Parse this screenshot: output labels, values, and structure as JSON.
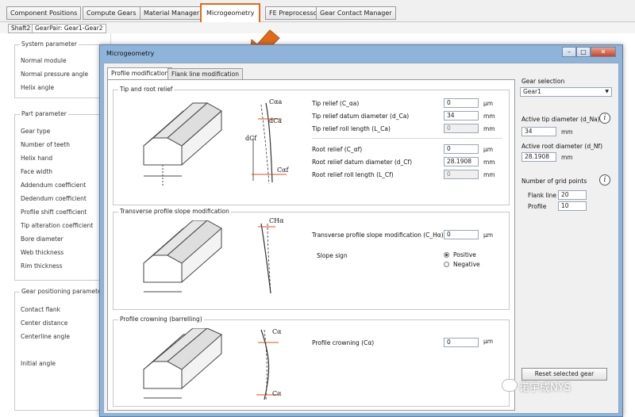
{
  "top_tabs": [
    {
      "label": "Component Positions"
    },
    {
      "label": "Compute Gears"
    },
    {
      "label": "Material Manager"
    },
    {
      "label": "Microgeometry"
    },
    {
      "label": "FE Preprocessor"
    },
    {
      "label": "Gear Contact Manager"
    }
  ],
  "sub_tabs": [
    {
      "label": "Shaft2"
    },
    {
      "label": "GearPair: Gear1-Gear2"
    }
  ],
  "background_panel": {
    "system_group": "System parameter",
    "system_labels": [
      "Normal module",
      "Normal pressure angle",
      "Helix angle"
    ],
    "part_group": "Part parameter",
    "part_labels": [
      "Gear type",
      "Number of teeth",
      "Helix hand",
      "Face width",
      "Addendum coefficient",
      "Dedendum coefficient",
      "Profile shift coefficient",
      "Tip alteration coefficient",
      "Bore diameter",
      "Web thickness",
      "Rim thickness"
    ],
    "positioning_group": "Gear positioning parameter",
    "positioning_labels": [
      "Contact flank",
      "Center distance",
      "Centerline angle",
      "Initial angle"
    ]
  },
  "dialog": {
    "title": "Microgeometry",
    "window_buttons": {
      "minimize": "–",
      "maximize": "□",
      "close": "✕"
    },
    "tabs": [
      {
        "label": "Profile modification"
      },
      {
        "label": "Flank line modification"
      }
    ],
    "tip_root": {
      "title": "Tip and root relief",
      "diagram_labels": {
        "c_alpha_a": "Cαa",
        "d_ca": "dCa",
        "d_cf": "dCf",
        "c_alpha_f": "Cαf"
      },
      "rows": [
        {
          "label": "Tip relief (C_αa)",
          "value": "0",
          "unit": "µm"
        },
        {
          "label": "Tip relief datum diameter (d_Ca)",
          "value": "34",
          "unit": "mm"
        },
        {
          "label": "Tip relief roll length (L_Ca)",
          "value": "0",
          "unit": "mm"
        },
        {
          "label": "Root relief (C_αf)",
          "value": "0",
          "unit": "µm"
        },
        {
          "label": "Root relief datum diameter (d_Cf)",
          "value": "28.1908",
          "unit": "mm"
        },
        {
          "label": "Root relief roll length (L_Cf)",
          "value": "0",
          "unit": "mm"
        }
      ]
    },
    "transverse": {
      "title": "Transverse profile slope modification",
      "diagram_label": "CHα",
      "row_label": "Transverse profile slope modification (C_Hα)",
      "value": "0",
      "unit": "µm",
      "slope_sign_label": "Slope sign",
      "options": [
        {
          "label": "Positive",
          "selected": true
        },
        {
          "label": "Negative",
          "selected": false
        }
      ]
    },
    "crowning": {
      "title": "Profile crowning (barrelling)",
      "diagram_label_top": "Cα",
      "diagram_label_bottom": "Cα",
      "row_label": "Profile crowning (Cα)",
      "value": "0",
      "unit": "µm"
    },
    "right": {
      "gear_selection_label": "Gear selection",
      "gear_selection_value": "Gear1",
      "active_tip_label": "Active tip diameter (d_Na)",
      "active_tip_value": "34",
      "active_tip_unit": "mm",
      "active_root_label": "Active root diameter (d_Nf)",
      "active_root_value": "28.1908",
      "active_root_unit": "mm",
      "grid_points_label": "Number of grid points",
      "flank_line_label": "Flank line",
      "flank_line_value": "20",
      "profile_label": "Profile",
      "profile_value": "10",
      "reset_button": "Reset selected gear",
      "info_glyph": "i"
    }
  },
  "watermark": "诺宇成NYS",
  "colors": {
    "highlight": "#e06a1a",
    "arrow": "#e06a1a",
    "dialog_frame": "#8fb4da"
  }
}
